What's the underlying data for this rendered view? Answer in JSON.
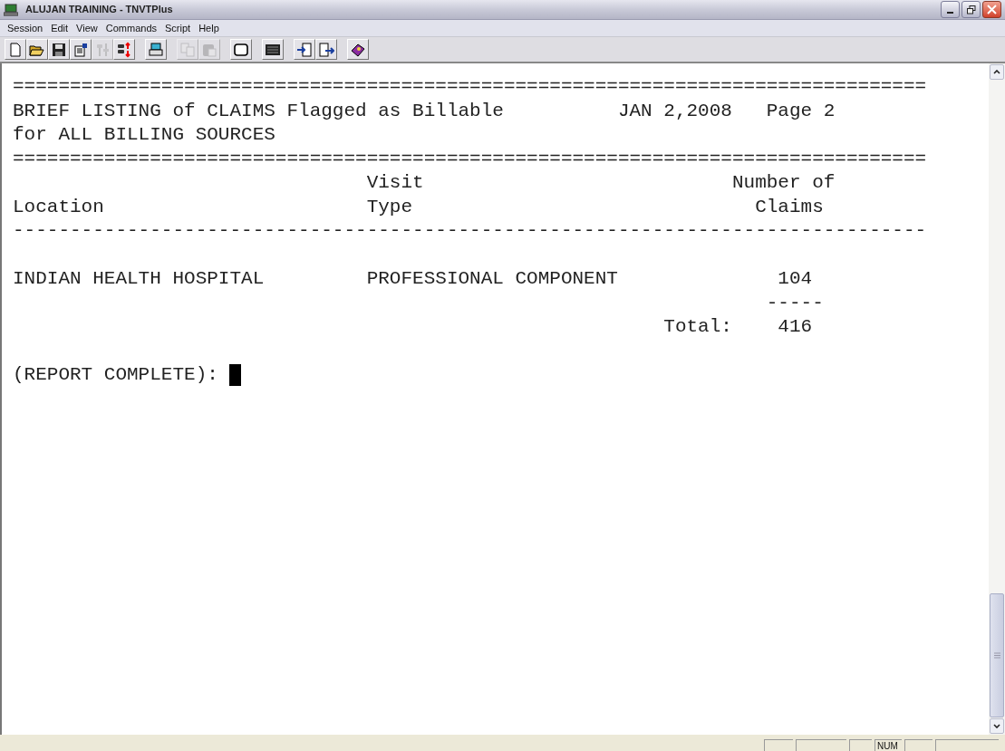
{
  "window": {
    "title": "ALUJAN TRAINING - TNVTPlus"
  },
  "menu": [
    "Session",
    "Edit",
    "View",
    "Commands",
    "Script",
    "Help"
  ],
  "toolbar": [
    {
      "kind": "new",
      "disabled": false
    },
    {
      "kind": "open",
      "disabled": false
    },
    {
      "kind": "save",
      "disabled": false
    },
    {
      "kind": "properties",
      "disabled": false
    },
    {
      "kind": "settings",
      "disabled": true
    },
    {
      "kind": "transfer",
      "disabled": false
    },
    {
      "kind": "separator"
    },
    {
      "kind": "print",
      "disabled": false
    },
    {
      "kind": "separator"
    },
    {
      "kind": "copy",
      "disabled": true
    },
    {
      "kind": "paste",
      "disabled": true
    },
    {
      "kind": "separator"
    },
    {
      "kind": "screen",
      "disabled": false
    },
    {
      "kind": "separator"
    },
    {
      "kind": "keyboard",
      "disabled": false
    },
    {
      "kind": "separator"
    },
    {
      "kind": "send",
      "disabled": false
    },
    {
      "kind": "receive",
      "disabled": false
    },
    {
      "kind": "separator"
    },
    {
      "kind": "help",
      "disabled": false
    }
  ],
  "terminal": {
    "lines": [
      {
        "kind": "text",
        "text": "================================================================================"
      },
      {
        "kind": "text",
        "text": "BRIEF LISTING of CLAIMS Flagged as Billable          JAN 2,2008   Page 2"
      },
      {
        "kind": "text",
        "text": "for ALL BILLING SOURCES"
      },
      {
        "kind": "text",
        "text": "================================================================================"
      },
      {
        "kind": "text",
        "text": "                               Visit                           Number of"
      },
      {
        "kind": "text",
        "text": "Location                       Type                              Claims"
      },
      {
        "kind": "text",
        "text": "--------------------------------------------------------------------------------"
      },
      {
        "kind": "blank"
      },
      {
        "kind": "text",
        "text": "INDIAN HEALTH HOSPITAL         PROFESSIONAL COMPONENT              104"
      },
      {
        "kind": "text",
        "text": "                                                                  -----"
      },
      {
        "kind": "text",
        "text": "                                                         Total:    416"
      },
      {
        "kind": "blank"
      },
      {
        "kind": "text",
        "text": "(REPORT COMPLETE): ",
        "cursor": true
      }
    ]
  },
  "status_bar": {
    "indicators": [
      "NUM"
    ]
  }
}
